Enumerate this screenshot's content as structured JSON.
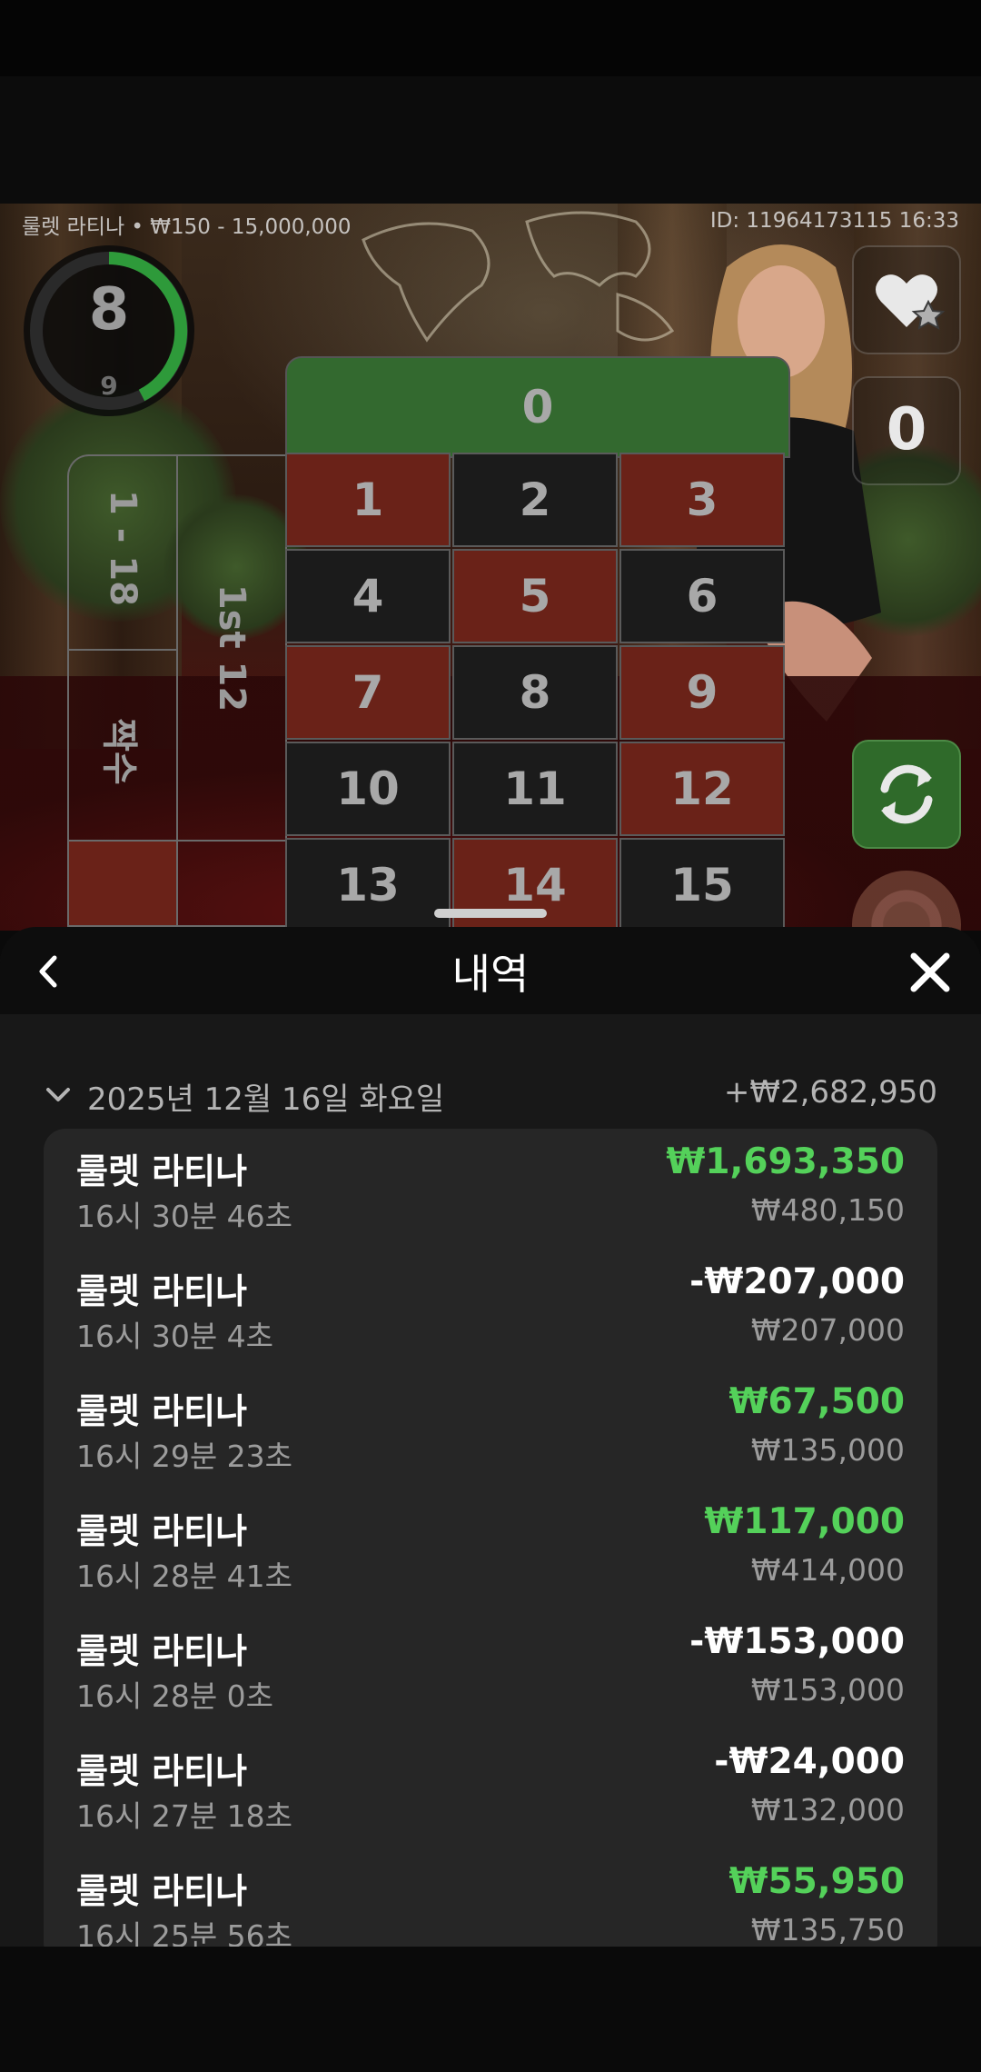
{
  "stream": {
    "table_info": "룰렛 라티나 • ₩150 - 15,000,000",
    "round_info": "ID: 11964173115  16:33",
    "timer_value": "8",
    "timer_sub": "9",
    "zero_button_label": "0"
  },
  "board": {
    "zero": "0",
    "cells": [
      {
        "n": "1",
        "c": "red"
      },
      {
        "n": "2",
        "c": "black"
      },
      {
        "n": "3",
        "c": "red"
      },
      {
        "n": "4",
        "c": "black"
      },
      {
        "n": "5",
        "c": "red"
      },
      {
        "n": "6",
        "c": "black"
      },
      {
        "n": "7",
        "c": "red"
      },
      {
        "n": "8",
        "c": "black"
      },
      {
        "n": "9",
        "c": "red"
      },
      {
        "n": "10",
        "c": "black"
      },
      {
        "n": "11",
        "c": "black"
      },
      {
        "n": "12",
        "c": "red"
      },
      {
        "n": "13",
        "c": "black"
      },
      {
        "n": "14",
        "c": "red"
      },
      {
        "n": "15",
        "c": "black"
      }
    ],
    "low_label": "1 - 18",
    "dozen_label": "1st 12",
    "even_label": "짝수"
  },
  "history": {
    "title": "내역",
    "day_label": "2025년 12월 16일 화요일",
    "day_total": "+₩2,682,950",
    "items": [
      {
        "name": "룰렛 라티나",
        "time": "16시 30분 46초",
        "amount": "₩1,693,350",
        "stake": "₩480,150",
        "type": "win"
      },
      {
        "name": "룰렛 라티나",
        "time": "16시 30분 4초",
        "amount": "-₩207,000",
        "stake": "₩207,000",
        "type": "loss"
      },
      {
        "name": "룰렛 라티나",
        "time": "16시 29분 23초",
        "amount": "₩67,500",
        "stake": "₩135,000",
        "type": "win"
      },
      {
        "name": "룰렛 라티나",
        "time": "16시 28분 41초",
        "amount": "₩117,000",
        "stake": "₩414,000",
        "type": "win"
      },
      {
        "name": "룰렛 라티나",
        "time": "16시 28분 0초",
        "amount": "-₩153,000",
        "stake": "₩153,000",
        "type": "loss"
      },
      {
        "name": "룰렛 라티나",
        "time": "16시 27분 18초",
        "amount": "-₩24,000",
        "stake": "₩132,000",
        "type": "loss"
      },
      {
        "name": "룰렛 라티나",
        "time": "16시 25분 56초",
        "amount": "₩55,950",
        "stake": "₩135,750",
        "type": "win"
      }
    ]
  },
  "colors": {
    "win": "#54d15a",
    "loss": "#ffffff",
    "timer_arc": "#2e9a3a",
    "zero_cell": "#33692f",
    "red_cell": "#6a2218",
    "black_cell": "#1b1b1b"
  },
  "icons": {
    "back": "chevron-left-icon",
    "close": "close-icon",
    "favorite": "heart-star-icon",
    "refresh": "refresh-icon",
    "day_toggle": "chevron-down-icon"
  }
}
